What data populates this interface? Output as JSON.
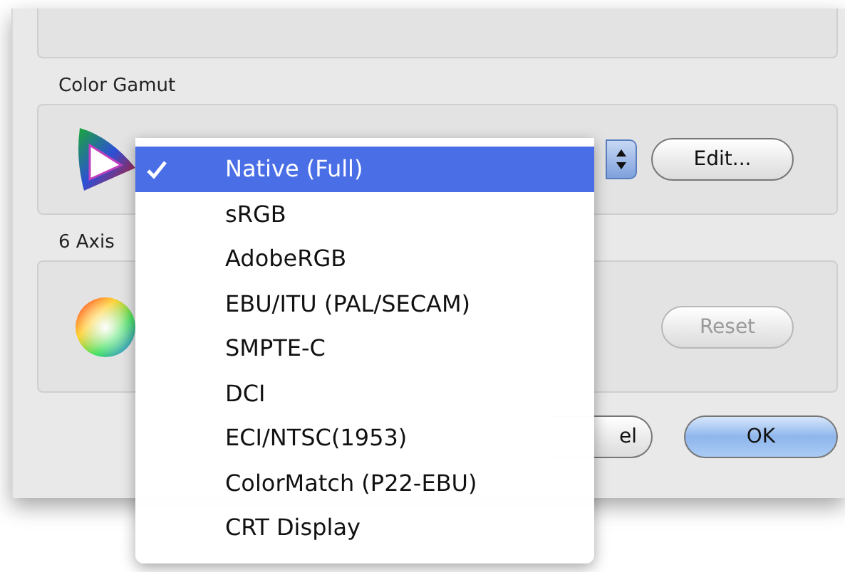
{
  "color_gamut": {
    "title": "Color Gamut",
    "edit_button": "Edit..."
  },
  "axis_panel": {
    "title": "6 Axis",
    "reset_button": {
      "label": "Reset",
      "disabled": true
    }
  },
  "buttons": [
    {
      "label": "el",
      "kind": "cancel"
    },
    {
      "label": "OK",
      "kind": "default"
    }
  ],
  "menu": {
    "items": [
      {
        "label": "Native (Full)",
        "selected": true
      },
      {
        "label": "sRGB",
        "selected": false
      },
      {
        "label": "AdobeRGB",
        "selected": false
      },
      {
        "label": "EBU/ITU (PAL/SECAM)",
        "selected": false
      },
      {
        "label": "SMPTE-C",
        "selected": false
      },
      {
        "label": "DCI",
        "selected": false
      },
      {
        "label": "ECI/NTSC(1953)",
        "selected": false
      },
      {
        "label": "ColorMatch (P22-EBU)",
        "selected": false
      },
      {
        "label": "CRT Display",
        "selected": false
      }
    ]
  }
}
